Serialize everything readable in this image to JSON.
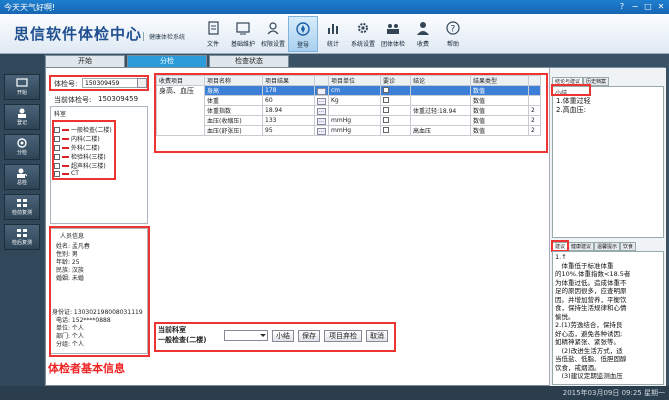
{
  "window": {
    "title": "今天天气好啊!",
    "controls": [
      "?",
      "−",
      "□",
      "✕"
    ]
  },
  "header": {
    "brand": "思信软件体检中心",
    "subbrand": "健康体检系统",
    "toolbar": [
      {
        "label": "文件",
        "icon": "file-icon"
      },
      {
        "label": "基础维护",
        "icon": "maintenance-icon"
      },
      {
        "label": "权限设置",
        "icon": "permission-icon"
      },
      {
        "label": "登导",
        "icon": "compass-icon"
      },
      {
        "label": "统计",
        "icon": "statistics-icon"
      },
      {
        "label": "系统设置",
        "icon": "settings-icon"
      },
      {
        "label": "团体体检",
        "icon": "group-icon"
      },
      {
        "label": "收费",
        "icon": "fee-icon"
      },
      {
        "label": "帮助",
        "icon": "help-icon"
      }
    ]
  },
  "leftnav": [
    {
      "label": "开始",
      "icon": "start-icon"
    },
    {
      "label": "登记",
      "icon": "register-icon"
    },
    {
      "label": "分检",
      "icon": "triage-icon"
    },
    {
      "label": "总检",
      "icon": "summary-icon"
    },
    {
      "label": "检前复测",
      "icon": "recheck-icon"
    },
    {
      "label": "检后复测",
      "icon": "postcheck-icon"
    }
  ],
  "tabs": [
    "开始",
    "分检",
    "检查状态"
  ],
  "patient": {
    "id_label": "体检号:",
    "id_value": "150309459",
    "current_label": "当前体检号:",
    "current_value": "150309459"
  },
  "departments": {
    "header": "科室",
    "items": [
      "一般检查(二楼)",
      "内科(二楼)",
      "外科(二楼)",
      "检验科(三楼)",
      "超声科(三楼)",
      "CT"
    ]
  },
  "person_info": {
    "title": "人员信息",
    "rows": [
      "姓名: 孟凡春",
      "性别: 男",
      "年龄: 25",
      "民族: 汉族",
      "婚姻: 未婚",
      "身份证: 130302198008031119",
      "电话: 152****0888",
      "单位: 个人",
      "部门: 个人",
      "分组: 个人"
    ],
    "annotation": "体检者基本信息"
  },
  "table": {
    "headers": [
      "收费项目",
      "项目名称",
      "项目结果",
      "",
      "项目单位",
      "要诊",
      "结论",
      "结果类型",
      ""
    ],
    "charge_item": "身高、血压",
    "rows": [
      {
        "name": "身高",
        "result": "178",
        "unit": "cm",
        "conclusion": "",
        "type": "数值",
        "extra": ""
      },
      {
        "name": "体重",
        "result": "60",
        "unit": "Kg",
        "conclusion": "",
        "type": "数值",
        "extra": ""
      },
      {
        "name": "体重指数",
        "result": "18.94",
        "unit": "",
        "conclusion": "体重过轻:18.94",
        "type": "数值",
        "extra": "2"
      },
      {
        "name": "血压(收缩压)",
        "result": "133",
        "unit": "mmHg",
        "conclusion": "",
        "type": "数值",
        "extra": "2"
      },
      {
        "name": "血压(舒张压)",
        "result": "95",
        "unit": "mmHg",
        "conclusion": "高血压",
        "type": "数值",
        "extra": "2"
      }
    ]
  },
  "bottom": {
    "dept_label": "当前科室",
    "dept_value": "一般检查(二楼)",
    "buttons": [
      "小结",
      "保存",
      "项目弃检",
      "取消"
    ]
  },
  "right": {
    "top_tabs": [
      "结论与建议",
      "历史档案"
    ],
    "summary_label": "小结",
    "summary_lines": [
      "1.体重过轻",
      "2.高血压:"
    ],
    "bottom_tabs": [
      "建议",
      "健康建议",
      "温馨提示",
      "饮食"
    ],
    "advice_lines": [
      "1.↑",
      "　体重低于标准体重",
      "的10%.体重指数<18.5者",
      "为体重过低。造成体重不",
      "足的原因很多，应查明原",
      "因。并增加营养，平衡饮",
      "食，保持生活规律和心情",
      "愉悦。",
      "2.(1)劳逸结合，保持良",
      "好心态，避免各种诱因;",
      "如精神紧张、紧张等。",
      "　(2)改进生活方式，适",
      "当低盐、低脂、低胆固醇",
      "饮食，戒烟酒。",
      "　(3)建议定期监测血压"
    ]
  },
  "status": {
    "datetime": "2015年03月09日 09:25 星期一"
  }
}
